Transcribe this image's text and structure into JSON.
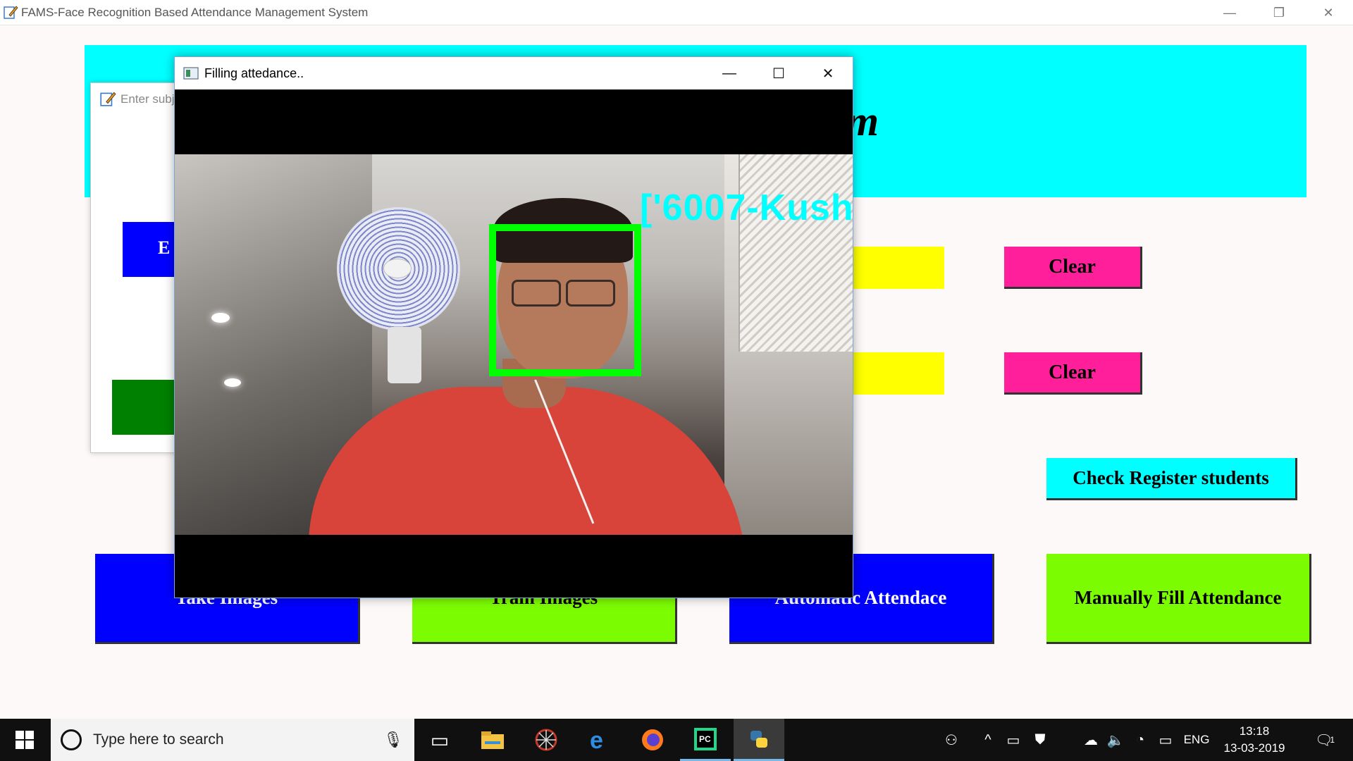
{
  "main_window": {
    "title": "FAMS-Face Recognition Based Attendance Management System",
    "banner_title": "Management-System",
    "controls": {
      "minimize": "—",
      "restore": "❐",
      "close": "✕"
    }
  },
  "buttons": {
    "clear_1": "Clear",
    "clear_2": "Clear",
    "check_register": "Check Register students",
    "take_images": "Take Images",
    "train_images": "Train Images",
    "automatic_attendance": "Automatic Attendace",
    "manual_attendance": "Manually Fill Attendance"
  },
  "subject_window": {
    "title": "Enter subj",
    "blue_button_fragment": "E"
  },
  "camera_window": {
    "title": "Filling attedance..",
    "controls": {
      "minimize": "—",
      "maximize": "☐",
      "close": "✕"
    },
    "recognized_label": "['6007-Kush"
  },
  "taskbar": {
    "search_placeholder": "Type here to search",
    "language": "ENG",
    "time": "13:18",
    "date": "13-03-2019",
    "notification_count": "1"
  },
  "colors": {
    "banner": "#00ffff",
    "clear_button": "#ff1f9a",
    "blue_button": "#0000ff",
    "lime_button": "#7cfc00",
    "yellow_field": "#ffff00",
    "face_box": "#00ff00",
    "face_label": "#00ffff"
  }
}
